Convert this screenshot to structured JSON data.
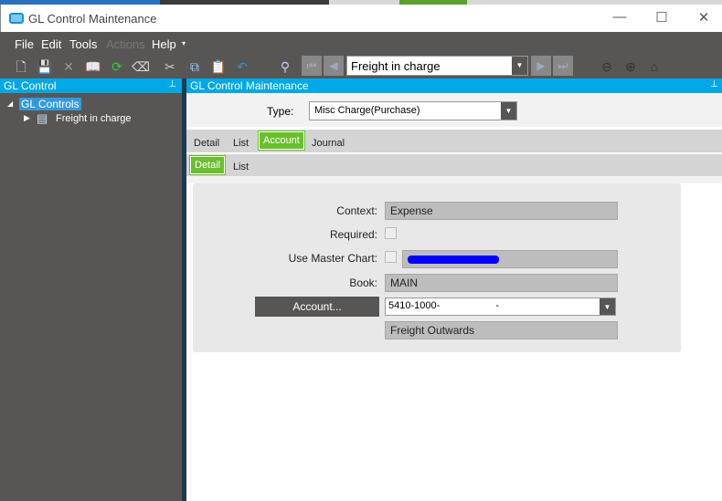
{
  "window": {
    "title": "GL Control Maintenance",
    "minimize": "—",
    "maximize": "☐",
    "close": "✕"
  },
  "menu": [
    "File",
    "Edit",
    "Tools",
    "Actions",
    "Help"
  ],
  "toolbar": {
    "record_selector": "Freight in charge"
  },
  "left_panel": {
    "title": "GL Control",
    "tree": {
      "root": "GL Controls",
      "children": [
        "Freight in charge"
      ]
    }
  },
  "main_panel": {
    "title": "GL Control Maintenance",
    "type_label": "Type:",
    "type_value": "Misc Charge(Purchase)",
    "tabs": [
      "Detail",
      "List",
      "Account",
      "Journal"
    ],
    "active_tab": "Account",
    "subtabs": [
      "Detail",
      "List"
    ],
    "active_subtab": "Detail",
    "form": {
      "context_label": "Context:",
      "context_value": "Expense",
      "required_label": "Required:",
      "required": false,
      "master_label": "Use Master Chart:",
      "master_chart": false,
      "book_label": "Book:",
      "book_value": "MAIN",
      "account_button": "Account...",
      "account_value": "5410-1000-                    -",
      "account_desc": "Freight Outwards"
    }
  },
  "colors": {
    "accent": "#00a9e6",
    "tab_active": "#6abf2c",
    "chrome": "#585654"
  }
}
